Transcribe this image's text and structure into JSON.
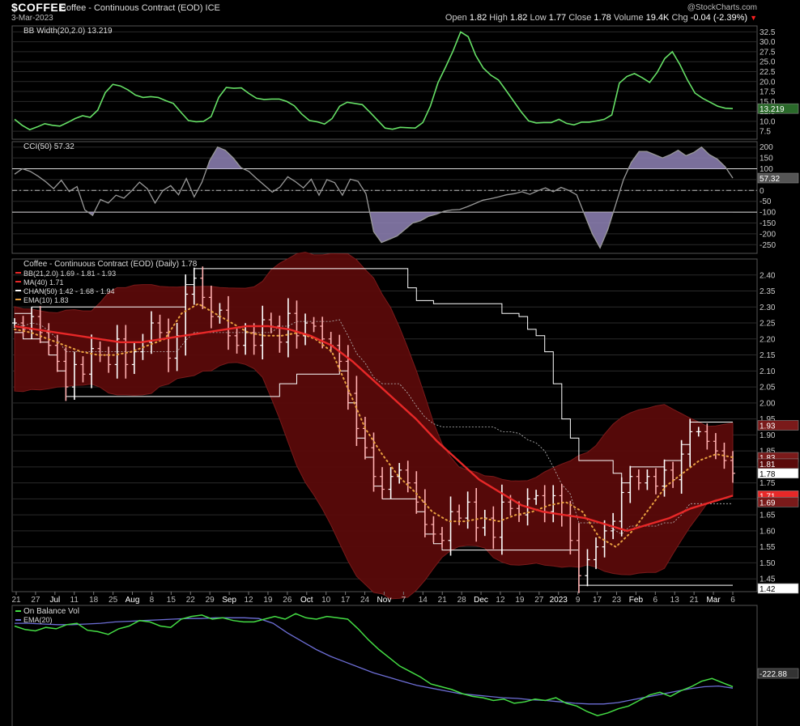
{
  "header": {
    "symbol": "$COFFEE",
    "name": "Coffee - Continuous Contract (EOD) ICE",
    "date": "3-Mar-2023",
    "brand": "@StockCharts.com",
    "open_label": "Open",
    "open": "1.82",
    "high_label": "High",
    "high": "1.82",
    "low_label": "Low",
    "low": "1.77",
    "close_label": "Close",
    "close": "1.78",
    "volume_label": "Volume",
    "volume": "19.4K",
    "chg_label": "Chg",
    "chg": "-0.04 (-2.39%)"
  },
  "colors": {
    "background": "#000000",
    "grid": "#2a2a2a",
    "up_bar": "#ffffff",
    "down_bar": "#ffb0b0",
    "bb_fill": "#5a0a0a",
    "ma": "#e82828",
    "channel": "#ffffff",
    "ema": "#e8a040",
    "bbw": "#66e066",
    "cci": "#999999",
    "cci_fill": "#8f82b6",
    "obv": "#44dd44",
    "obv_ema": "#6d6ed6"
  },
  "chart_data": [
    {
      "type": "line",
      "title": "BB Width(20,2.0) 13.219",
      "ylim": [
        5.5,
        34
      ],
      "ticks": [
        "32.5",
        "30.0",
        "27.5",
        "25.0",
        "22.5",
        "20.0",
        "17.5",
        "15.0",
        "12.5",
        "10.0",
        "7.5"
      ],
      "last_label": "13.219",
      "series": [
        {
          "name": "BB Width(20,2.0)",
          "values": [
            10.5,
            9.0,
            7.9,
            8.6,
            9.4,
            9.0,
            8.8,
            9.7,
            10.7,
            11.4,
            11.0,
            12.8,
            17.2,
            19.3,
            18.9,
            17.9,
            16.6,
            16.0,
            16.2,
            16.0,
            15.2,
            14.5,
            12.3,
            10.2,
            9.9,
            10.0,
            11.2,
            16.0,
            18.5,
            18.3,
            18.4,
            17.0,
            15.8,
            15.5,
            15.6,
            15.6,
            15.0,
            13.9,
            11.8,
            10.2,
            9.9,
            9.3,
            10.7,
            13.8,
            14.8,
            14.5,
            14.2,
            12.3,
            10.3,
            8.3,
            8.0,
            8.5,
            8.4,
            8.3,
            9.7,
            13.8,
            19.7,
            23.6,
            27.7,
            32.5,
            31.3,
            26.6,
            23.4,
            21.6,
            20.4,
            17.8,
            15.1,
            12.4,
            10.1,
            9.6,
            9.7,
            9.7,
            10.5,
            9.5,
            9.1,
            9.8,
            9.8,
            10.1,
            10.5,
            11.6,
            19.6,
            21.3,
            22.0,
            21.0,
            19.8,
            22.3,
            25.8,
            27.5,
            24.3,
            20.4,
            17.1,
            15.8,
            14.8,
            13.8,
            13.3,
            13.2
          ]
        }
      ]
    },
    {
      "type": "area",
      "title": "CCI(50) 57.32",
      "ylim": [
        -290,
        225
      ],
      "ticks": [
        "200",
        "150",
        "100",
        "50",
        "0",
        "-50",
        "-100",
        "-150",
        "-200",
        "-250"
      ],
      "last_label": "57.32",
      "series": [
        {
          "name": "CCI(50)",
          "values": [
            75,
            100,
            88,
            66,
            40,
            8,
            47,
            -5,
            18,
            -90,
            -115,
            -42,
            -58,
            -22,
            -36,
            -2,
            38,
            8,
            -58,
            0,
            22,
            -20,
            55,
            -30,
            38,
            138,
            200,
            185,
            150,
            105,
            88,
            55,
            24,
            -8,
            16,
            63,
            40,
            12,
            52,
            -22,
            50,
            36,
            -22,
            52,
            42,
            -15,
            -190,
            -240,
            -225,
            -210,
            -180,
            -150,
            -140,
            -120,
            -110,
            -96,
            -90,
            -88,
            -75,
            -60,
            -45,
            -38,
            -30,
            -20,
            -15,
            -6,
            -18,
            -2,
            12,
            -6,
            14,
            0,
            -20,
            -110,
            -200,
            -265,
            -180,
            -65,
            50,
            130,
            180,
            180,
            165,
            150,
            165,
            185,
            160,
            175,
            200,
            165,
            145,
            110,
            57
          ]
        }
      ]
    },
    {
      "type": "line",
      "title": "Coffee - Continuous Contract (EOD) (Daily) 1.78",
      "ylim": [
        1.41,
        2.45
      ],
      "ticks": [
        "2.40",
        "2.35",
        "2.30",
        "2.25",
        "2.20",
        "2.15",
        "2.10",
        "2.05",
        "2.00",
        "1.95",
        "1.90",
        "1.85",
        "1.80",
        "1.75",
        "1.70",
        "1.65",
        "1.60",
        "1.55",
        "1.50",
        "1.45"
      ],
      "x_ticks": [
        "21",
        "27",
        "Jul",
        "11",
        "18",
        "25",
        "Aug",
        "8",
        "15",
        "22",
        "29",
        "Sep",
        "12",
        "19",
        "26",
        "Oct",
        "10",
        "17",
        "24",
        "Nov",
        "7",
        "14",
        "21",
        "28",
        "Dec",
        "12",
        "19",
        "27",
        "2023",
        "9",
        "17",
        "23",
        "Feb",
        "6",
        "13",
        "21",
        "Mar",
        "6"
      ],
      "right_labels": [
        "1.93",
        "1.83",
        "1.81",
        "1.78",
        "1.71",
        "1.69",
        "1.42"
      ],
      "legend": [
        "BB(21,2.0) 1.69 - 1.81 - 1.93",
        "MA(40) 1.71",
        "CHAN(50) 1.42 - 1.68 - 1.94",
        "EMA(10) 1.83"
      ],
      "series": [
        {
          "name": "Close",
          "values": [
            2.25,
            2.23,
            2.27,
            2.22,
            2.18,
            2.13,
            2.05,
            2.12,
            2.09,
            2.17,
            2.15,
            2.12,
            2.2,
            2.12,
            2.16,
            2.19,
            2.25,
            2.22,
            2.14,
            2.21,
            2.34,
            2.39,
            2.33,
            2.27,
            2.29,
            2.21,
            2.18,
            2.22,
            2.18,
            2.26,
            2.24,
            2.19,
            2.28,
            2.21,
            2.25,
            2.24,
            2.2,
            2.18,
            2.13,
            2.03,
            1.92,
            1.86,
            1.77,
            1.73,
            1.77,
            1.79,
            1.75,
            1.69,
            1.62,
            1.59,
            1.57,
            1.66,
            1.64,
            1.69,
            1.61,
            1.64,
            1.58,
            1.69,
            1.67,
            1.65,
            1.7,
            1.71,
            1.66,
            1.71,
            1.65,
            1.57,
            1.46,
            1.51,
            1.55,
            1.6,
            1.63,
            1.72,
            1.77,
            1.75,
            1.77,
            1.74,
            1.79,
            1.76,
            1.84,
            1.91,
            1.91,
            1.88,
            1.85,
            1.82,
            1.78
          ]
        },
        {
          "name": "MA(40)",
          "values": [
            2.24,
            2.23,
            2.22,
            2.21,
            2.2,
            2.19,
            2.19,
            2.2,
            2.21,
            2.22,
            2.23,
            2.24,
            2.24,
            2.23,
            2.21,
            2.18,
            2.13,
            2.07,
            2.01,
            1.95,
            1.88,
            1.82,
            1.76,
            1.72,
            1.68,
            1.66,
            1.65,
            1.64,
            1.62,
            1.6,
            1.62,
            1.64,
            1.67,
            1.69,
            1.71
          ]
        },
        {
          "name": "EMA(10)",
          "values": [
            2.23,
            2.22,
            2.2,
            2.18,
            2.16,
            2.15,
            2.15,
            2.16,
            2.18,
            2.2,
            2.28,
            2.31,
            2.28,
            2.25,
            2.22,
            2.21,
            2.21,
            2.22,
            2.2,
            2.16,
            2.04,
            1.92,
            1.84,
            1.77,
            1.72,
            1.66,
            1.63,
            1.63,
            1.64,
            1.63,
            1.65,
            1.66,
            1.68,
            1.69,
            1.66,
            1.58,
            1.55,
            1.6,
            1.67,
            1.74,
            1.78,
            1.82,
            1.84,
            1.83
          ]
        }
      ]
    },
    {
      "type": "line",
      "title": "On Balance Vol",
      "last_label": "-222.88",
      "series": [
        {
          "name": "On Balance Vol",
          "values": [
            50,
            45,
            43,
            48,
            46,
            52,
            54,
            44,
            42,
            38,
            46,
            50,
            58,
            56,
            50,
            48,
            60,
            64,
            66,
            60,
            62,
            58,
            56,
            56,
            60,
            64,
            60,
            68,
            62,
            60,
            64,
            62,
            60,
            46,
            30,
            16,
            4,
            -8,
            -16,
            -24,
            -34,
            -38,
            -42,
            -48,
            -52,
            -54,
            -58,
            -56,
            -62,
            -60,
            -56,
            -58,
            -54,
            -62,
            -66,
            -74,
            -80,
            -76,
            -70,
            -66,
            -58,
            -50,
            -46,
            -52,
            -44,
            -38,
            -30,
            -26,
            -32,
            -38
          ]
        },
        {
          "name": "EMA(20)",
          "values": [
            54,
            54,
            53,
            52,
            52,
            53,
            54,
            56,
            57,
            58,
            59,
            60,
            61,
            61,
            62,
            62,
            62,
            61,
            54,
            40,
            28,
            16,
            6,
            -2,
            -10,
            -18,
            -24,
            -30,
            -36,
            -40,
            -44,
            -48,
            -50,
            -52,
            -54,
            -55,
            -57,
            -58,
            -60,
            -62,
            -63,
            -63,
            -61,
            -57,
            -53,
            -49,
            -45,
            -41,
            -38,
            -37,
            -40
          ]
        }
      ]
    }
  ]
}
